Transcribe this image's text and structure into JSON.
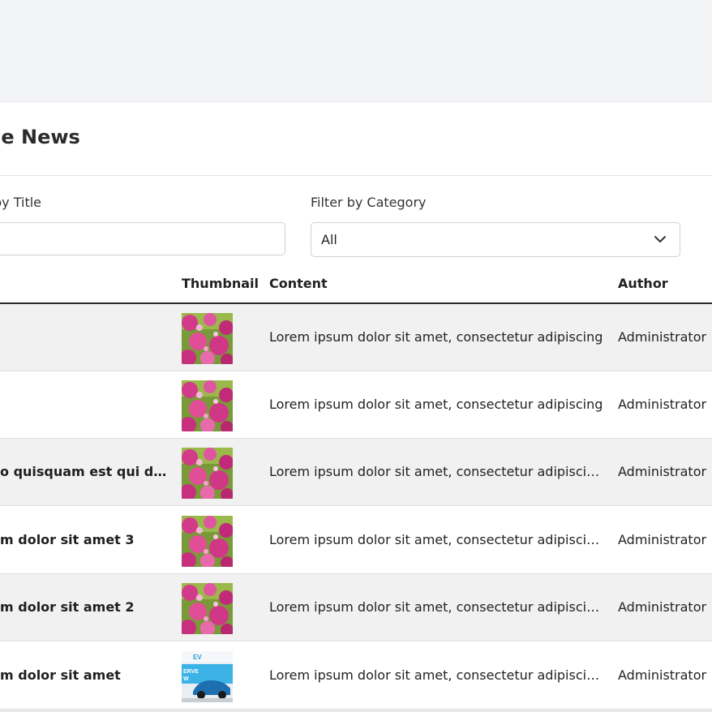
{
  "page": {
    "title": "age News"
  },
  "filters": {
    "search_label": "by Title",
    "search_value": "",
    "category_label": "Filter by Category",
    "category_value": "All"
  },
  "table": {
    "columns": [
      "Thumbnail",
      "Content",
      "Author"
    ],
    "rows": [
      {
        "title": "",
        "thumbnail": "flowers-image",
        "content": "Lorem ipsum dolor sit amet, consectetur adipiscing",
        "author": "Administrator"
      },
      {
        "title": "",
        "thumbnail": "flowers-image",
        "content": "Lorem ipsum dolor sit amet, consectetur adipiscing",
        "author": "Administrator"
      },
      {
        "title": "o quisquam est qui dol...",
        "thumbnail": "flowers-image",
        "content": "Lorem ipsum dolor sit amet, consectetur adipiscing...",
        "author": "Administrator"
      },
      {
        "title": "m dolor sit amet 3",
        "thumbnail": "flowers-image",
        "content": "Lorem ipsum dolor sit amet, consectetur adipiscing...",
        "author": "Administrator"
      },
      {
        "title": "m dolor sit amet 2",
        "thumbnail": "flowers-image",
        "content": "Lorem ipsum dolor sit amet, consectetur adipiscing...",
        "author": "Administrator"
      },
      {
        "title": "m dolor sit amet",
        "thumbnail": "car-ad-image",
        "content": "Lorem ipsum dolor sit amet, consectetur adipiscing...",
        "author": "Administrator"
      }
    ]
  },
  "colors": {
    "topbar": "#f3f4f6",
    "stripe": "#f1f1f1"
  }
}
